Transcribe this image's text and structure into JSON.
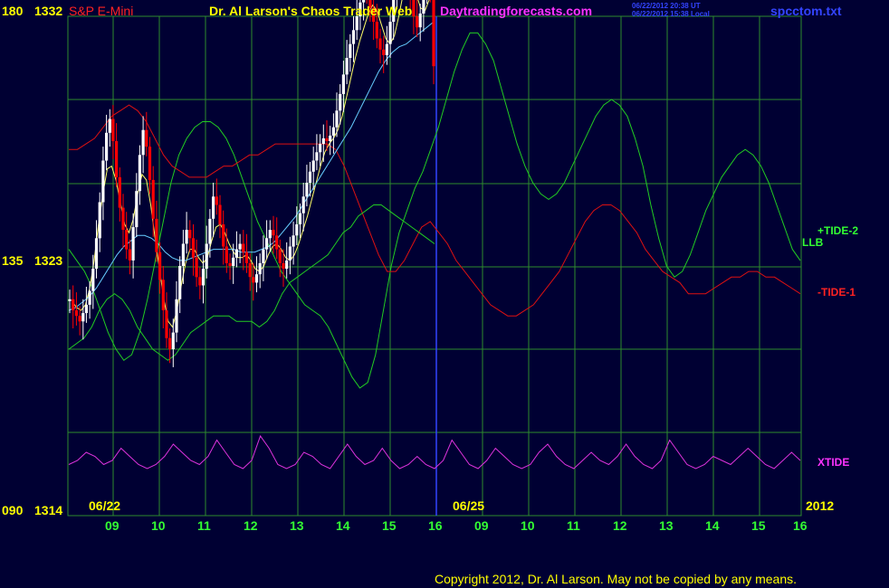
{
  "header": {
    "symbol": "S&P E-Mini",
    "title": "Dr. Al Larson's Chaos Trader Web",
    "site": "Daytradingforecasts.com",
    "timestamp_ut": "06/22/2012 20:38 UT",
    "timestamp_local": "06/22/2012 15:38 Local",
    "file": "spcctom.txt"
  },
  "footer": {
    "copyright": "Copyright 2012, Dr. Al Larson. May not be copied by any means."
  },
  "colors": {
    "background": "#000033",
    "grid": "#2e8b2e",
    "price_up": "#ffffff",
    "price_down": "#ff0000",
    "ma_fast": "#ffff66",
    "ma_slow": "#66ccff",
    "tide_plus2": "#22cc22",
    "tide_minus1": "#dd1111",
    "xtide": "#dd33dd",
    "axis_text_yellow": "#ffff00",
    "axis_text_green": "#33ff33",
    "copyright": "#ffff00",
    "site": "#ff33ff",
    "file": "#3333ff"
  },
  "chart_data": {
    "type": "line",
    "title": "S&P E-Mini",
    "y_left_labels": [
      {
        "angle": "180",
        "price": "1332"
      },
      {
        "angle": "135",
        "price": "1323"
      },
      {
        "angle": "090",
        "price": "1314"
      }
    ],
    "date_labels": [
      "06/22",
      "06/25"
    ],
    "year_label": "2012",
    "x_hour_labels": [
      "09",
      "10",
      "11",
      "12",
      "13",
      "14",
      "15",
      "16",
      "09",
      "10",
      "11",
      "12",
      "13",
      "14",
      "15",
      "16"
    ],
    "series_labels": [
      {
        "name": "+TIDE-2",
        "color": "#33ff33"
      },
      {
        "name": "LLB",
        "color": "#33ff33"
      },
      {
        "name": "-TIDE-1",
        "color": "#ff2222"
      },
      {
        "name": "XTIDE",
        "color": "#ff33ff"
      }
    ],
    "price_bars": {
      "unit": "price",
      "closes": [
        1321.8,
        1321.4,
        1321.2,
        1321.0,
        1321.3,
        1321.6,
        1322.1,
        1322.9,
        1324.0,
        1325.3,
        1326.8,
        1327.8,
        1328.3,
        1327.5,
        1326.2,
        1325.1,
        1324.3,
        1323.6,
        1323.2,
        1324.4,
        1325.7,
        1327.0,
        1327.9,
        1327.3,
        1326.1,
        1324.7,
        1323.5,
        1322.5,
        1321.4,
        1320.4,
        1320.0,
        1320.6,
        1321.8,
        1323.0,
        1323.8,
        1324.3,
        1324.0,
        1323.3,
        1322.6,
        1322.3,
        1322.9,
        1323.8,
        1324.7,
        1325.5,
        1325.2,
        1324.5,
        1323.7,
        1323.1,
        1323.0,
        1323.3,
        1323.6,
        1323.8,
        1323.5,
        1323.1,
        1322.6,
        1322.4,
        1322.7,
        1323.1,
        1323.6,
        1324.0,
        1324.3,
        1324.1,
        1323.6,
        1323.1,
        1322.9,
        1323.2,
        1323.7,
        1324.1,
        1324.5,
        1324.9,
        1325.5,
        1326.0,
        1326.4,
        1326.8,
        1327.1,
        1327.4,
        1327.6,
        1327.5,
        1327.7,
        1328.0,
        1328.6,
        1329.2,
        1329.9,
        1330.5,
        1331.0,
        1331.5,
        1332.0,
        1332.5,
        1333.0,
        1332.8,
        1332.3,
        1331.8,
        1331.2,
        1330.8,
        1330.6,
        1331.0,
        1331.8,
        1332.6,
        1333.4,
        1334.0,
        1333.8,
        1333.2,
        1332.6,
        1332.0,
        1331.6,
        1332.1,
        1332.8,
        1333.3,
        1333.0,
        1330.2
      ]
    },
    "moving_averages": {
      "fast": [
        1321.7,
        1321.5,
        1321.4,
        1321.6,
        1322.2,
        1323.2,
        1324.5,
        1325.6,
        1326.5,
        1326.6,
        1326.1,
        1325.3,
        1324.5,
        1324.2,
        1324.7,
        1325.6,
        1326.3,
        1326.1,
        1325.2,
        1324.0,
        1322.9,
        1321.8,
        1321.0,
        1320.8,
        1321.4,
        1322.3,
        1323.1,
        1323.6,
        1323.6,
        1323.3,
        1323.1,
        1323.3,
        1323.9,
        1324.4,
        1324.5,
        1324.2,
        1323.8,
        1323.5,
        1323.3,
        1323.3,
        1323.4,
        1323.2,
        1322.9,
        1322.8,
        1323.0,
        1323.4,
        1323.7,
        1323.8,
        1323.6,
        1323.3,
        1323.2,
        1323.4,
        1323.8,
        1324.3,
        1324.8,
        1325.4,
        1326.0,
        1326.6,
        1327.1,
        1327.4,
        1327.6,
        1327.9,
        1328.4,
        1329.1,
        1329.8,
        1330.5,
        1331.1,
        1331.6,
        1332.1,
        1332.4,
        1332.2,
        1331.7,
        1331.2,
        1331.0,
        1331.3,
        1332.0,
        1332.8,
        1333.3,
        1333.3,
        1332.8,
        1332.3,
        1332.2,
        1332.6,
        1332.8
      ],
      "slow": [
        1321.4,
        1321.5,
        1321.7,
        1321.9,
        1322.2,
        1322.6,
        1323.0,
        1323.4,
        1323.7,
        1323.9,
        1324.1,
        1324.1,
        1324.0,
        1323.8,
        1323.5,
        1323.3,
        1323.2,
        1323.2,
        1323.3,
        1323.4,
        1323.5,
        1323.6,
        1323.6,
        1323.6,
        1323.6,
        1323.5,
        1323.5,
        1323.5,
        1323.6,
        1323.7,
        1323.9,
        1324.2,
        1324.5,
        1324.8,
        1325.2,
        1325.6,
        1326.0,
        1326.4,
        1326.8,
        1327.2,
        1327.6,
        1328.0,
        1328.5,
        1329.0,
        1329.5,
        1330.0,
        1330.4,
        1330.7,
        1330.9,
        1331.0,
        1331.2,
        1331.4,
        1331.6,
        1331.8
      ]
    },
    "cycles": {
      "tide_plus2_green": [
        138,
        136,
        134,
        131,
        127,
        123,
        120,
        118,
        119,
        123,
        129,
        136,
        143,
        150,
        155,
        158,
        160,
        161,
        161,
        160,
        158,
        155,
        151,
        147,
        143,
        140,
        137,
        134,
        132,
        130,
        128,
        127,
        126,
        124,
        121,
        118,
        115,
        113,
        114,
        119,
        127,
        135,
        141,
        145,
        149,
        152,
        156,
        160,
        165,
        170,
        174,
        177,
        177,
        175,
        172,
        167,
        162,
        157,
        153,
        150,
        148,
        147,
        148,
        150,
        153,
        156,
        159,
        162,
        164,
        165,
        164,
        162,
        158,
        153,
        146,
        140,
        135,
        133,
        134,
        137,
        141,
        145,
        148,
        151,
        153,
        155,
        156,
        155,
        153,
        150,
        146,
        142,
        138,
        136
      ],
      "tide_minus1_red": [
        156,
        156,
        157,
        158,
        160,
        162,
        163,
        164,
        163,
        161,
        158,
        155,
        153,
        152,
        151,
        151,
        151,
        152,
        153,
        153,
        154,
        155,
        155,
        156,
        157,
        157,
        157,
        157,
        157,
        157,
        157,
        156,
        153,
        149,
        145,
        141,
        137,
        134,
        134,
        136,
        139,
        142,
        143,
        141,
        139,
        136,
        134,
        132,
        130,
        128,
        127,
        126,
        126,
        127,
        128,
        130,
        132,
        134,
        137,
        140,
        143,
        145,
        146,
        146,
        145,
        143,
        141,
        138,
        136,
        134,
        133,
        132,
        130,
        130,
        130,
        131,
        132,
        133,
        133,
        134,
        134,
        133,
        133,
        132,
        131,
        130
      ],
      "green_second": [
        120,
        121,
        122,
        124,
        127,
        129,
        130,
        129,
        127,
        124,
        122,
        120,
        119,
        118,
        119,
        121,
        123,
        124,
        125,
        126,
        126,
        126,
        125,
        125,
        125,
        124,
        125,
        127,
        130,
        132,
        133,
        134,
        135,
        136,
        137,
        139,
        141,
        142,
        144,
        145,
        146,
        146,
        145,
        144,
        143,
        142,
        141,
        140,
        139
      ],
      "xtide": [
        0.3,
        0.4,
        0.6,
        0.5,
        0.3,
        0.4,
        0.7,
        0.5,
        0.3,
        0.2,
        0.3,
        0.5,
        0.8,
        0.6,
        0.4,
        0.3,
        0.5,
        0.9,
        0.6,
        0.3,
        0.2,
        0.4,
        1.0,
        0.7,
        0.3,
        0.2,
        0.3,
        0.6,
        0.5,
        0.3,
        0.2,
        0.5,
        0.8,
        0.5,
        0.3,
        0.4,
        0.7,
        0.4,
        0.2,
        0.3,
        0.5,
        0.3,
        0.2,
        0.4,
        0.9,
        0.6,
        0.3,
        0.2,
        0.4,
        0.7,
        0.5,
        0.3,
        0.2,
        0.3,
        0.6,
        0.8,
        0.5,
        0.3,
        0.2,
        0.4,
        0.6,
        0.4,
        0.3,
        0.5,
        0.8,
        0.5,
        0.3,
        0.2,
        0.4,
        0.9,
        0.6,
        0.3,
        0.2,
        0.3,
        0.5,
        0.4,
        0.3,
        0.5,
        0.7,
        0.5,
        0.3,
        0.2,
        0.4,
        0.6,
        0.4
      ]
    }
  }
}
